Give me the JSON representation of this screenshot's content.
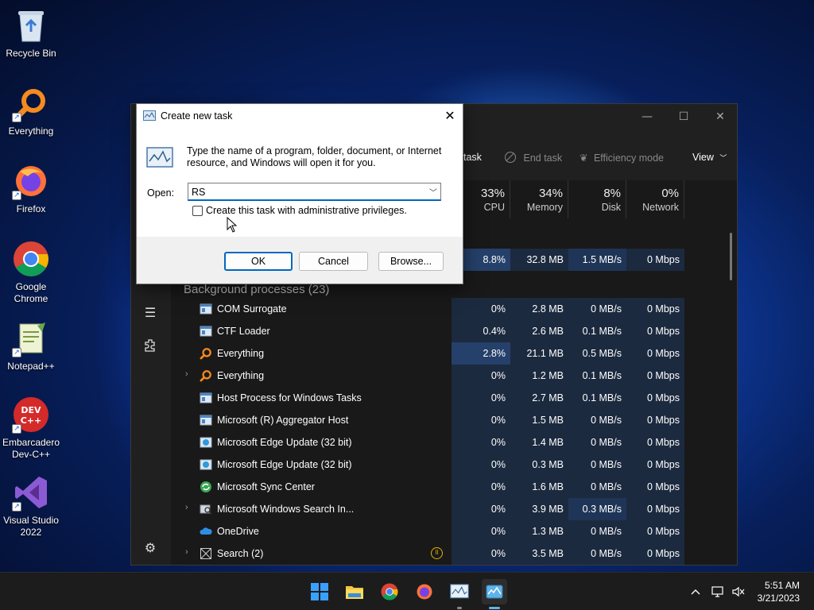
{
  "desktop": {
    "icons": [
      {
        "label": "Recycle Bin",
        "icon": "recycle-bin-icon"
      },
      {
        "label": "Everything",
        "icon": "everything-icon"
      },
      {
        "label": "Firefox",
        "icon": "firefox-icon"
      },
      {
        "label": "Google Chrome",
        "icon": "chrome-icon"
      },
      {
        "label": "Notepad++",
        "icon": "notepadpp-icon"
      },
      {
        "label": "Embarcadero Dev-C++",
        "icon": "devcpp-icon"
      },
      {
        "label": "Visual Studio 2022",
        "icon": "visual-studio-icon"
      }
    ]
  },
  "task_manager": {
    "toolbar": {
      "run_task_label": "task",
      "end_task_label": "End task",
      "efficiency_label": "Efficiency mode",
      "view_label": "View"
    },
    "columns": [
      {
        "pct": "33%",
        "name": "CPU"
      },
      {
        "pct": "34%",
        "name": "Memory"
      },
      {
        "pct": "8%",
        "name": "Disk"
      },
      {
        "pct": "0%",
        "name": "Network"
      }
    ],
    "top_row": {
      "cpu": "8.8%",
      "memory": "32.8 MB",
      "disk": "1.5 MB/s",
      "network": "0 Mbps"
    },
    "section_title": "Background processes (23)",
    "processes": [
      {
        "name": "COM Surrogate",
        "expand": false,
        "icon": "generic-window-icon",
        "cpu": "0%",
        "memory": "2.8 MB",
        "disk": "0 MB/s",
        "network": "0 Mbps"
      },
      {
        "name": "CTF Loader",
        "expand": false,
        "icon": "generic-window-icon",
        "cpu": "0.4%",
        "memory": "2.6 MB",
        "disk": "0.1 MB/s",
        "network": "0 Mbps"
      },
      {
        "name": "Everything",
        "expand": false,
        "icon": "everything-icon",
        "cpu": "2.8%",
        "memory": "21.1 MB",
        "disk": "0.5 MB/s",
        "network": "0 Mbps"
      },
      {
        "name": "Everything",
        "expand": true,
        "icon": "everything-icon",
        "cpu": "0%",
        "memory": "1.2 MB",
        "disk": "0.1 MB/s",
        "network": "0 Mbps"
      },
      {
        "name": "Host Process for Windows Tasks",
        "expand": false,
        "icon": "generic-window-icon",
        "cpu": "0%",
        "memory": "2.7 MB",
        "disk": "0.1 MB/s",
        "network": "0 Mbps"
      },
      {
        "name": "Microsoft (R) Aggregator Host",
        "expand": false,
        "icon": "generic-window-icon",
        "cpu": "0%",
        "memory": "1.5 MB",
        "disk": "0 MB/s",
        "network": "0 Mbps"
      },
      {
        "name": "Microsoft Edge Update (32 bit)",
        "expand": false,
        "icon": "edge-update-icon",
        "cpu": "0%",
        "memory": "1.4 MB",
        "disk": "0 MB/s",
        "network": "0 Mbps"
      },
      {
        "name": "Microsoft Edge Update (32 bit)",
        "expand": false,
        "icon": "edge-update-icon",
        "cpu": "0%",
        "memory": "0.3 MB",
        "disk": "0 MB/s",
        "network": "0 Mbps"
      },
      {
        "name": "Microsoft Sync Center",
        "expand": false,
        "icon": "sync-center-icon",
        "cpu": "0%",
        "memory": "1.6 MB",
        "disk": "0 MB/s",
        "network": "0 Mbps"
      },
      {
        "name": "Microsoft Windows Search In...",
        "expand": true,
        "icon": "search-indexer-icon",
        "cpu": "0%",
        "memory": "3.9 MB",
        "disk": "0.3 MB/s",
        "network": "0 Mbps"
      },
      {
        "name": "OneDrive",
        "expand": false,
        "icon": "onedrive-icon",
        "cpu": "0%",
        "memory": "1.3 MB",
        "disk": "0 MB/s",
        "network": "0 Mbps"
      },
      {
        "name": "Search (2)",
        "expand": true,
        "icon": "search-app-icon",
        "cpu": "0%",
        "memory": "3.5 MB",
        "disk": "0 MB/s",
        "network": "0 Mbps"
      }
    ]
  },
  "run_dialog": {
    "title": "Create new task",
    "description": "Type the name of a program, folder, document, or Internet resource, and Windows will open it for you.",
    "open_label": "Open:",
    "input_value": "RS",
    "admin_checkbox_label": "Create this task with administrative privileges.",
    "admin_checked": false,
    "ok_label": "OK",
    "cancel_label": "Cancel",
    "browse_label": "Browse..."
  },
  "taskbar": {
    "apps": [
      "start-icon",
      "file-explorer-icon",
      "chrome-icon",
      "firefox-icon",
      "run-dialog-icon",
      "task-manager-icon"
    ],
    "time": "5:51 AM",
    "date": "3/21/2023"
  }
}
